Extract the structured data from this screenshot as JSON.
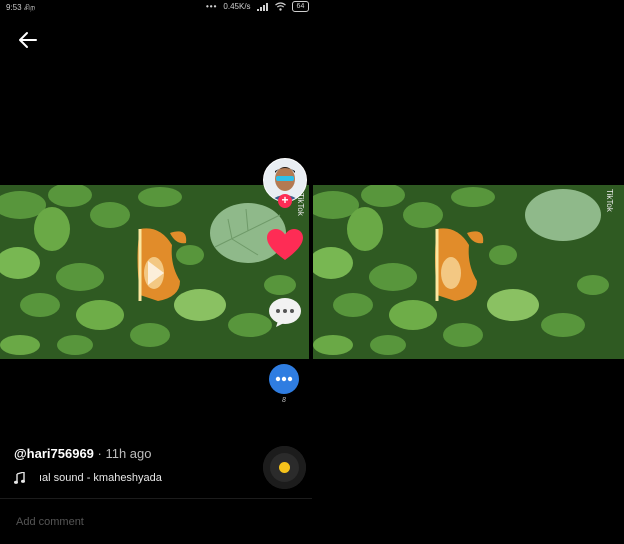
{
  "status_bar": {
    "time": "9:53 சிற",
    "network": "0.45K/s",
    "battery": "64"
  },
  "video": {
    "watermark": "TikTok",
    "share_count": "8"
  },
  "post": {
    "username": "@hari756969",
    "time_ago": " · 11h ago",
    "sound": "ıal sound - kmaheshyada"
  },
  "comment": {
    "placeholder": "Add comment"
  },
  "colors": {
    "like_red": "#fe2c55",
    "share_blue": "#2f7de1",
    "disc_center": "#f5c21b"
  },
  "icons": [
    "back-arrow-icon",
    "heart-icon",
    "comment-icon",
    "share-icon",
    "music-note-icon",
    "wifi-icon",
    "signal-icon",
    "battery-icon"
  ]
}
